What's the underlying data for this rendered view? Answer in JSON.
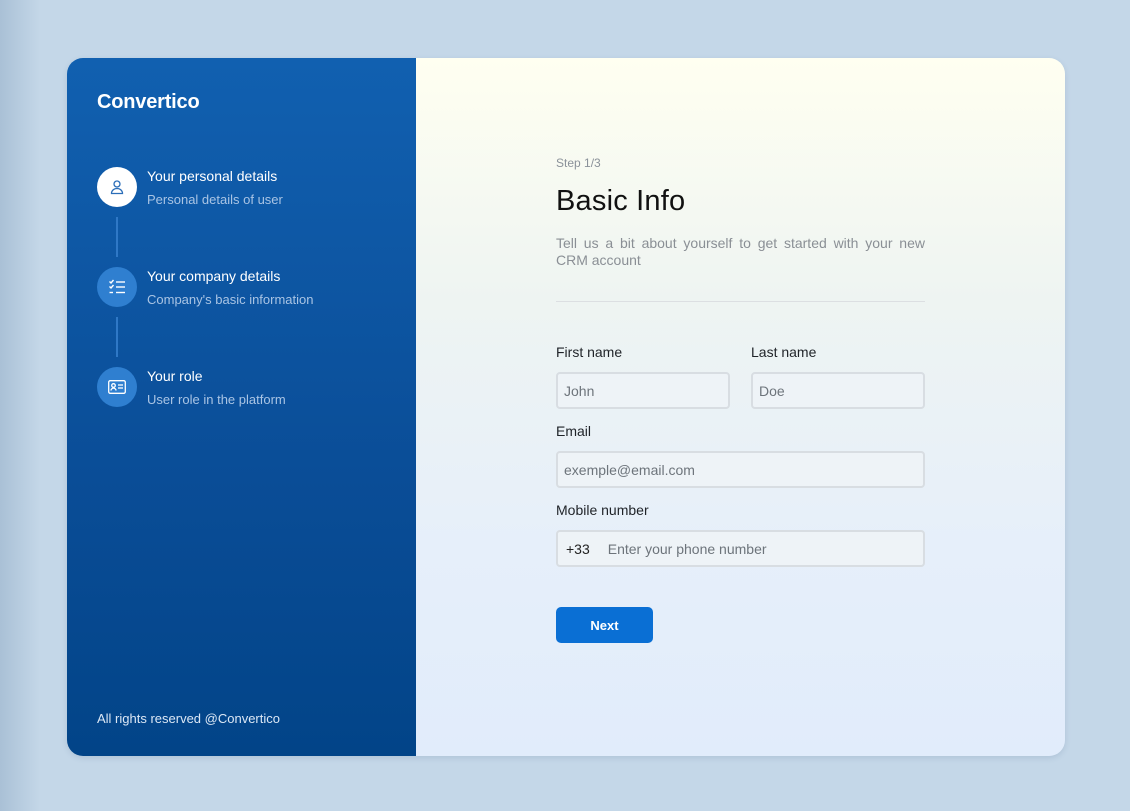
{
  "brand": "Convertico",
  "steps": [
    {
      "title": "Your personal details",
      "subtitle": "Personal details of user",
      "icon": "user-icon",
      "active": true
    },
    {
      "title": "Your company details",
      "subtitle": "Company's basic information",
      "icon": "checklist-icon",
      "active": false
    },
    {
      "title": "Your role",
      "subtitle": "User role in the platform",
      "icon": "id-card-icon",
      "active": false
    }
  ],
  "footer": "All rights reserved @Convertico",
  "form": {
    "step_label": "Step 1/3",
    "title": "Basic Info",
    "subtitle": "Tell us a bit about yourself to get started with your new CRM account",
    "first_name": {
      "label": "First name",
      "placeholder": "John"
    },
    "last_name": {
      "label": "Last name",
      "placeholder": "Doe"
    },
    "email": {
      "label": "Email",
      "placeholder": "exemple@email.com"
    },
    "mobile": {
      "label": "Mobile number",
      "prefix": "+33",
      "placeholder": "Enter your phone number"
    },
    "next_label": "Next"
  },
  "colors": {
    "sidebar": "#0a4d97",
    "accent": "#0a6fd4",
    "background": "#c4d7e8"
  }
}
